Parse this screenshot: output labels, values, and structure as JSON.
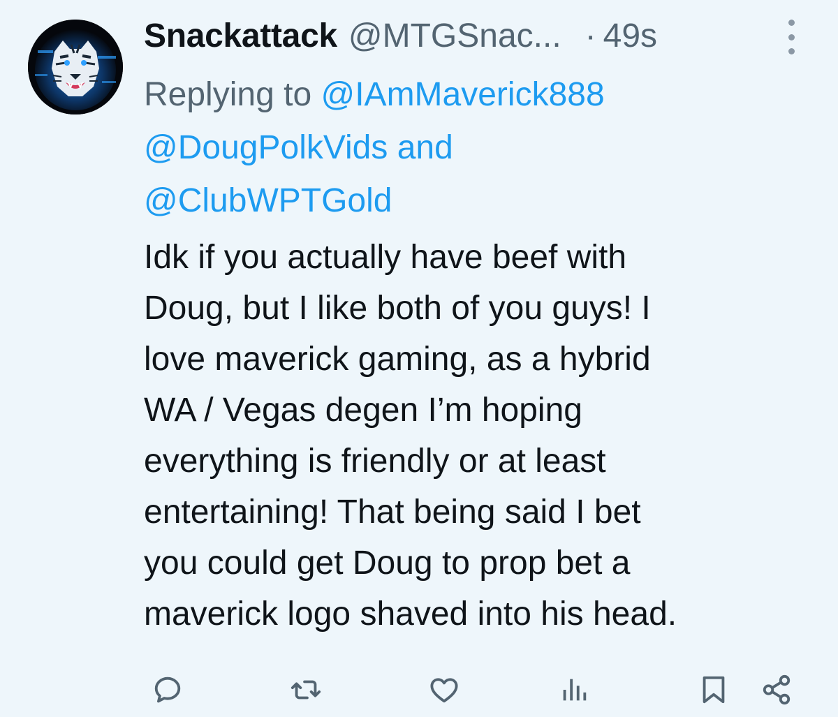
{
  "tweet": {
    "author": {
      "display_name": "Snackattack",
      "handle": "@MTGSnac...",
      "avatar_icon": "tiger-avatar"
    },
    "separator": "·",
    "timestamp": "49s",
    "more_icon": "more-vertical-icon",
    "reply": {
      "prefix": "Replying to",
      "mentions": [
        "@IAmMaverick888",
        "@DougPolkVids",
        "@ClubWPTGold"
      ],
      "conjunction": "and"
    },
    "text_lines": [
      "Idk if you actually have beef with",
      "Doug, but I like both of you guys! I",
      "love maverick gaming, as a hybrid",
      "WA / Vegas degen I’m hoping",
      "everything is friendly or at least",
      "entertaining! That being said I bet",
      "you could get Doug to prop bet a",
      "maverick logo shaved into his head."
    ],
    "actions": [
      {
        "name": "reply",
        "icon": "reply-icon"
      },
      {
        "name": "retweet",
        "icon": "retweet-icon"
      },
      {
        "name": "like",
        "icon": "heart-icon"
      },
      {
        "name": "views",
        "icon": "views-icon"
      },
      {
        "name": "bookmark",
        "icon": "bookmark-icon"
      },
      {
        "name": "share",
        "icon": "share-icon"
      }
    ]
  },
  "colors": {
    "background": "#eef6fb",
    "text": "#0f1419",
    "secondary": "#536471",
    "link": "#1d9bf0",
    "icon": "#536471"
  }
}
